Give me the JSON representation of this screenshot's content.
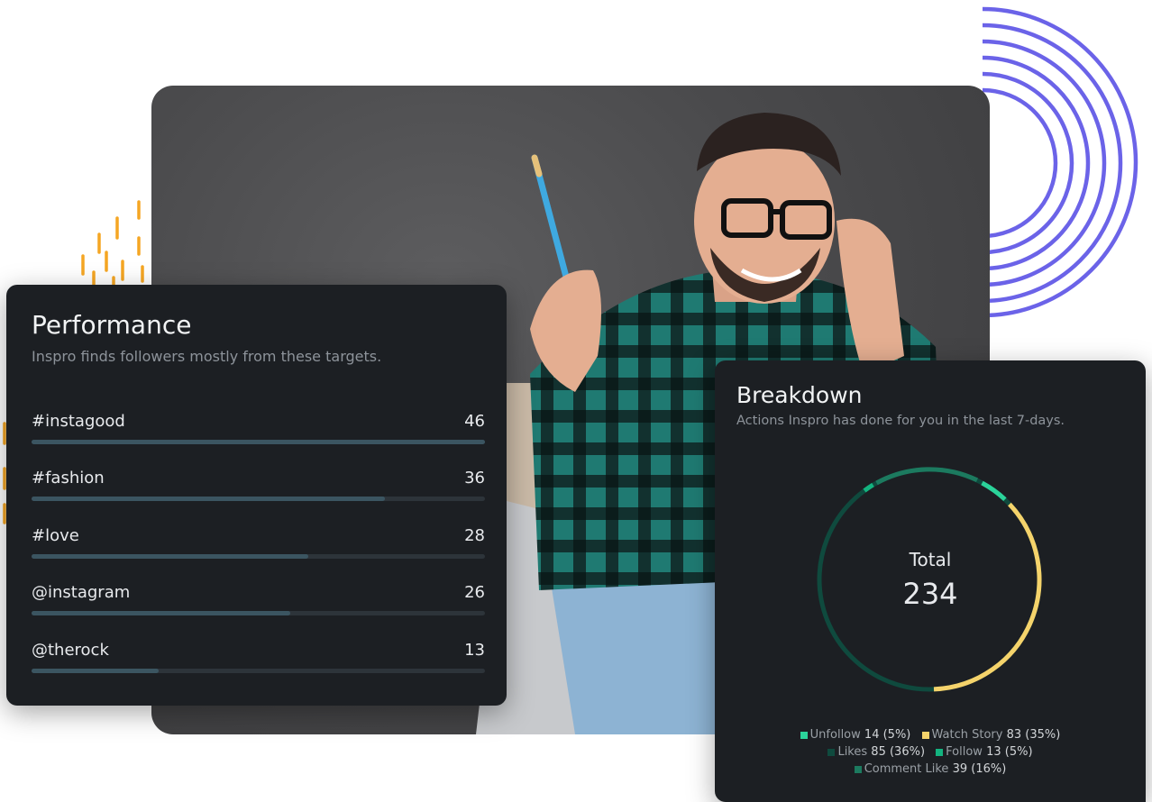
{
  "colors": {
    "accent_purple": "#6b63e8",
    "accent_orange": "#f5a623",
    "card_bg": "#1c1f23",
    "bar_fill": "#3b5561"
  },
  "performance": {
    "title": "Performance",
    "subtitle": "Inspro finds followers mostly from these targets.",
    "items": [
      {
        "label": "#instagood",
        "value": "46",
        "fraction": 1.0
      },
      {
        "label": "#fashion",
        "value": "36",
        "fraction": 0.78
      },
      {
        "label": "#love",
        "value": "28",
        "fraction": 0.61
      },
      {
        "label": "@instagram",
        "value": "26",
        "fraction": 0.57
      },
      {
        "label": "@therock",
        "value": "13",
        "fraction": 0.28
      }
    ]
  },
  "breakdown": {
    "title": "Breakdown",
    "subtitle": "Actions Inspro has done for you in the last 7-days.",
    "total_label": "Total",
    "total_value": "234",
    "legend": [
      {
        "name": "Unfollow",
        "count": "14 (5%)",
        "color": "#2bd39a"
      },
      {
        "name": "Watch Story",
        "count": "83 (35%)",
        "color": "#f5d36b"
      },
      {
        "name": "Likes",
        "count": "85 (36%)",
        "color": "#0f4a3e"
      },
      {
        "name": "Follow",
        "count": "13 (5%)",
        "color": "#13b37f"
      },
      {
        "name": "Comment Like",
        "count": "39 (16%)",
        "color": "#1c7a5f"
      }
    ]
  }
}
